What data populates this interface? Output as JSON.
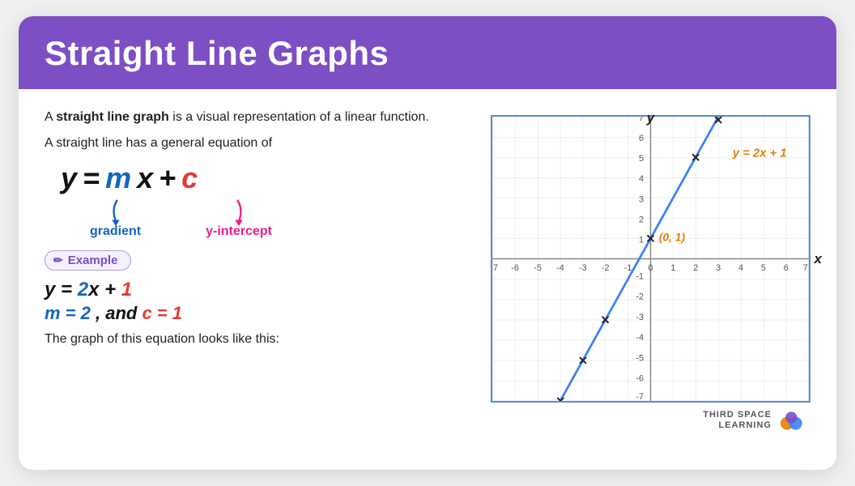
{
  "header": {
    "title": "Straight Line Graphs",
    "bg_color": "#7c4fc4"
  },
  "intro": {
    "line1a": "A ",
    "line1b": "straight line graph",
    "line1c": " is a visual representation",
    "line2": "of a linear function.",
    "line3": "A straight line has a general equation of"
  },
  "general_equation": {
    "display": "y = mx + c",
    "annotation_gradient": "gradient",
    "annotation_yintercept": "y-intercept"
  },
  "example_badge": {
    "label": "Example",
    "icon": "✏️"
  },
  "example": {
    "equation": "y = 2x + 1",
    "detail_m": "m = 2",
    "detail_and": " , and ",
    "detail_c": "c = 1"
  },
  "bottom_text": "The graph of this equation looks like this:",
  "graph": {
    "x_min": -7,
    "x_max": 7,
    "y_min": -7,
    "y_max": 7,
    "label_x": "x",
    "label_y": "y",
    "line_equation_label": "y = 2x + 1",
    "intercept_label": "(0, 1)",
    "accent_color": "#e67e00",
    "line_color": "#3b82f6",
    "points": [
      {
        "x": -4,
        "y": -7
      },
      {
        "x": -3,
        "y": -5
      },
      {
        "x": -2,
        "y": -3
      },
      {
        "x": 0,
        "y": 1
      },
      {
        "x": 2,
        "y": 5
      },
      {
        "x": 3,
        "y": 7
      }
    ]
  },
  "logo": {
    "line1": "THIRD SPACE",
    "line2": "LEARNING"
  }
}
